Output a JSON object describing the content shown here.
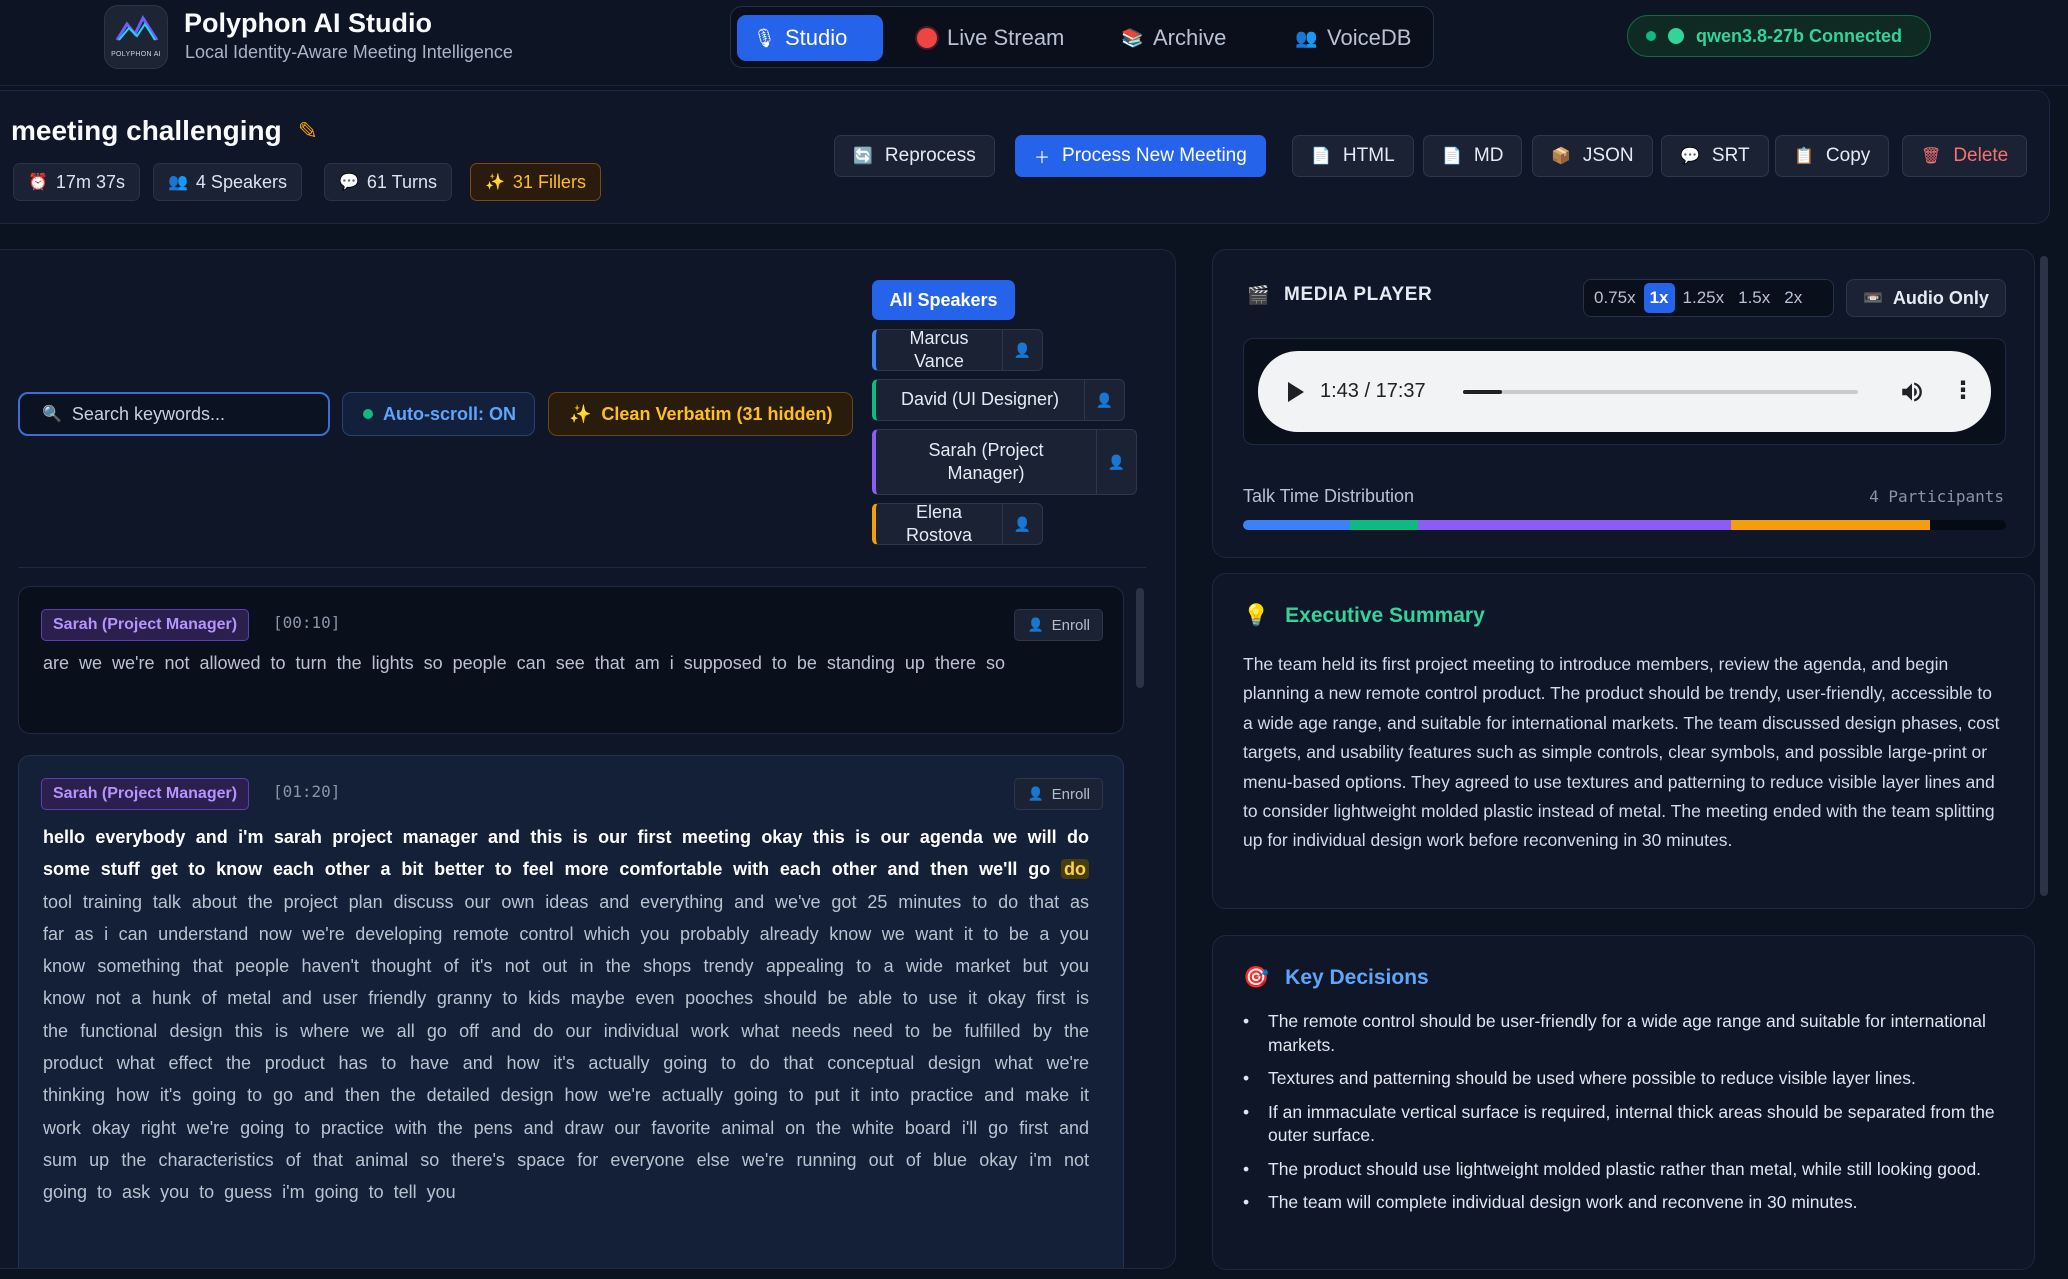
{
  "app": {
    "logo_text": "POLYPHON AI",
    "title": "Polyphon AI Studio",
    "subtitle": "Local Identity-Aware Meeting Intelligence"
  },
  "nav": {
    "tabs": [
      {
        "label": "Studio",
        "icon": "microphone-icon",
        "active": true
      },
      {
        "label": "Live Stream",
        "icon": "red-dot-icon",
        "active": false
      },
      {
        "label": "Archive",
        "icon": "books-icon",
        "active": false
      },
      {
        "label": "VoiceDB",
        "icon": "people-icon",
        "active": false
      }
    ]
  },
  "status": {
    "label": "qwen3.8-27b Connected",
    "color": "#34d399"
  },
  "meeting": {
    "title": "meeting challenging",
    "stats": {
      "duration": "17m 37s",
      "speakers": "4 Speakers",
      "turns": "61 Turns",
      "fillers": "31 Fillers"
    },
    "actions": {
      "reprocess": "Reprocess",
      "process_new": "Process New Meeting",
      "html": "HTML",
      "md": "MD",
      "json": "JSON",
      "srt": "SRT",
      "copy": "Copy",
      "delete": "Delete"
    }
  },
  "transcript": {
    "search_placeholder": "Search keywords...",
    "autoscroll": "Auto-scroll: ON",
    "verbatim": "Clean Verbatim (31 hidden)",
    "all_speakers": "All Speakers",
    "speakers": [
      {
        "name": "Marcus Vance",
        "color": "#3b82f6"
      },
      {
        "name": "David (UI Designer)",
        "color": "#10b981"
      },
      {
        "name": "Sarah (Project Manager)",
        "color": "#8b5cf6"
      },
      {
        "name": "Elena Rostova",
        "color": "#f59e0b"
      }
    ],
    "enroll_label": "Enroll",
    "segments": [
      {
        "speaker": "Sarah (Project Manager)",
        "time": "[00:10]",
        "text": "are we we're not allowed to turn the lights so people can see that am i supposed to be standing up there so"
      },
      {
        "speaker": "Sarah (Project Manager)",
        "time": "[01:20]",
        "spoken": "hello everybody and i'm sarah project manager and this is our first meeting okay this is our agenda we will do some stuff get to know each other a bit better to feel more comfortable with each other and then we'll go",
        "current": "do",
        "rest": "tool training talk about the project plan discuss our own ideas and everything and we've got 25 minutes to do that as far as i can understand now we're developing remote control which you probably already know we want it to be a you know something that people haven't thought of it's not out in the shops trendy appealing to a wide market but you know not a hunk of metal and user friendly granny to kids maybe even pooches should be able to use it okay first is the functional design this is where we all go off and do our individual work what needs need to be fulfilled by the product what effect the product has to have and how it's actually going to do that conceptual design what we're thinking how it's going to go and then the detailed design how we're actually going to put it into practice and make it work okay right we're going to practice with the pens and draw our favorite animal on the white board i'll go first and sum up the characteristics of that animal so there's space for everyone else we're running out of blue okay i'm not going to ask you to guess i'm going to tell you"
      }
    ]
  },
  "media": {
    "title": "MEDIA PLAYER",
    "speeds": [
      "0.75x",
      "1x",
      "1.25x",
      "1.5x",
      "2x"
    ],
    "active_speed": "1x",
    "audio_only": "Audio Only",
    "time": "1:43 / 17:37",
    "progress": 0.098,
    "talk_time_label": "Talk Time Distribution",
    "participants": "4 Participants",
    "talk_time": [
      {
        "speaker": "Marcus Vance",
        "share": 0.14,
        "color": "#3b82f6"
      },
      {
        "speaker": "David (UI Designer)",
        "share": 0.09,
        "color": "#10b981"
      },
      {
        "speaker": "Sarah (Project Manager)",
        "share": 0.41,
        "color": "#8b5cf6"
      },
      {
        "speaker": "Elena Rostova",
        "share": 0.26,
        "color": "#f59e0b"
      }
    ]
  },
  "summary": {
    "title": "Executive Summary",
    "text": "The team held its first project meeting to introduce members, review the agenda, and begin planning a new remote control product. The product should be trendy, user-friendly, accessible to a wide age range, and suitable for international markets. The team discussed design phases, cost targets, and usability features such as simple controls, clear symbols, and possible large-print or menu-based options. They agreed to use textures and patterning to reduce visible layer lines and to consider lightweight molded plastic instead of metal. The meeting ended with the team splitting up for individual design work before reconvening in 30 minutes."
  },
  "decisions": {
    "title": "Key Decisions",
    "items": [
      "The remote control should be user-friendly for a wide age range and suitable for international markets.",
      "Textures and patterning should be used where possible to reduce visible layer lines.",
      "If an immaculate vertical surface is required, internal thick areas should be separated from the outer surface.",
      "The product should use lightweight molded plastic rather than metal, while still looking good.",
      "The team will complete individual design work and reconvene in 30 minutes."
    ]
  }
}
